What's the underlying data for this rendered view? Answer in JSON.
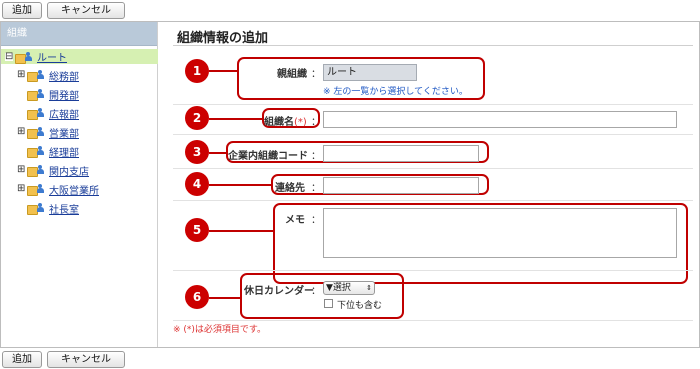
{
  "toolbar": {
    "add_label": "追加",
    "cancel_label": "キャンセル"
  },
  "sidebar": {
    "header": "組織",
    "root": "ルート",
    "items": [
      {
        "label": "総務部",
        "expand": "⊞"
      },
      {
        "label": "開発部",
        "expand": ""
      },
      {
        "label": "広報部",
        "expand": ""
      },
      {
        "label": "営業部",
        "expand": "⊞"
      },
      {
        "label": "経理部",
        "expand": ""
      },
      {
        "label": "関内支店",
        "expand": "⊞"
      },
      {
        "label": "大阪営業所",
        "expand": "⊞"
      },
      {
        "label": "社長室",
        "expand": ""
      }
    ],
    "root_expand": "⊟"
  },
  "main": {
    "title": "組織情報の追加",
    "colon": "：",
    "callouts": [
      "1",
      "2",
      "3",
      "4",
      "5",
      "6"
    ],
    "parent": {
      "label": "親組織",
      "value": "ルート",
      "hint": "※ 左の一覧から選択してください。"
    },
    "name": {
      "label": "組織名",
      "required_mark": "(*)",
      "value": ""
    },
    "code": {
      "label": "企業内組織コード",
      "value": ""
    },
    "contact": {
      "label": "連絡先",
      "value": ""
    },
    "memo": {
      "label": "メモ",
      "value": ""
    },
    "calendar": {
      "label": "休日カレンダー",
      "selected": "▼選択",
      "sub_label": "下位も含む"
    },
    "required_note": "※ (*)は必須項目です。"
  },
  "colors": {
    "accent": "#cc0000",
    "sidebar_header": "#b9c9d9",
    "selected_row": "#d6f0b2",
    "link": "#1a3d99",
    "hint": "#1f58c4"
  }
}
